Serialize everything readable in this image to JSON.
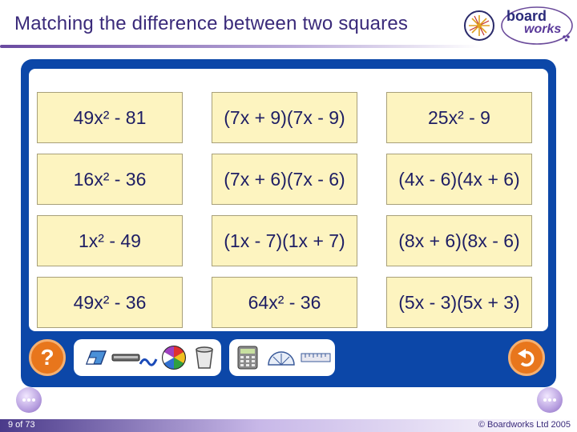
{
  "header": {
    "title": "Matching the difference between two squares",
    "logo_text_top": "board",
    "logo_text_bottom": "works"
  },
  "cards": [
    [
      "49x² - 81",
      "(7x + 9)(7x - 9)",
      "25x² - 9"
    ],
    [
      "16x² - 36",
      "(7x + 6)(7x - 6)",
      "(4x - 6)(4x + 6)"
    ],
    [
      "1x² - 49",
      "(1x - 7)(1x + 7)",
      "(8x + 6)(8x - 6)"
    ],
    [
      "49x² - 36",
      "64x² - 36",
      "(5x - 3)(5x + 3)"
    ]
  ],
  "toolbar": {
    "help_label": "?",
    "tools": [
      "eraser-icon",
      "ruler-icon",
      "pen-icon",
      "color-wheel-icon",
      "bin-icon",
      "calculator-icon",
      "protractor-icon",
      "long-ruler-icon"
    ],
    "undo_icon": "undo-icon"
  },
  "colors": {
    "panel": "#0c47a8",
    "card": "#fdf4c0",
    "accent": "#e8761c",
    "title": "#3a2a7a"
  },
  "footer": {
    "slide_number": "9 of 73",
    "copyright": "© Boardworks Ltd 2005"
  }
}
